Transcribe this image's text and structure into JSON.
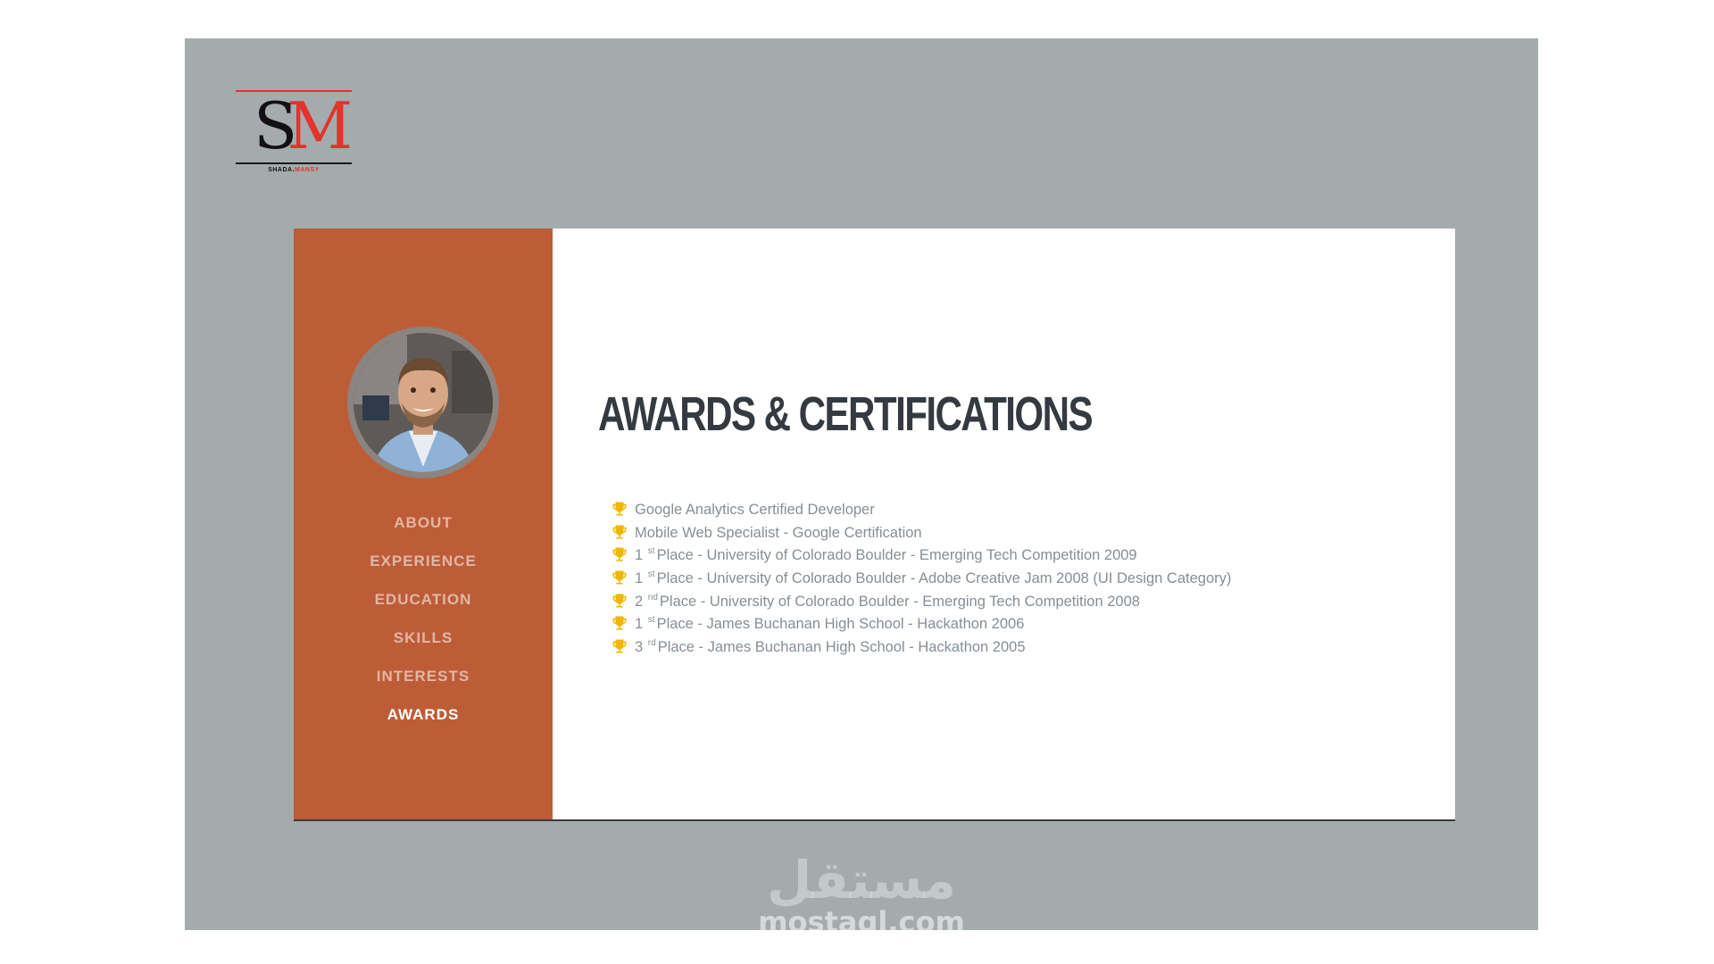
{
  "logo": {
    "mark_s": "S",
    "mark_m": "M",
    "sub_dark": "SHADA.",
    "sub_red": "MANSY"
  },
  "sidebar": {
    "accent_color": "#bd5d38",
    "nav": [
      {
        "label": "About",
        "active": false
      },
      {
        "label": "Experience",
        "active": false
      },
      {
        "label": "Education",
        "active": false
      },
      {
        "label": "Skills",
        "active": false
      },
      {
        "label": "Interests",
        "active": false
      },
      {
        "label": "Awards",
        "active": true
      }
    ]
  },
  "main": {
    "title": "AWARDS & CERTIFICATIONS",
    "trophy_color": "#f1b600",
    "awards": [
      {
        "text": "Google Analytics Certified Developer"
      },
      {
        "text": "Mobile Web Specialist - Google Certification"
      },
      {
        "num": "1",
        "sup": "st",
        "text": "Place - University of Colorado Boulder - Emerging Tech Competition 2009"
      },
      {
        "num": "1",
        "sup": "st",
        "text": "Place - University of Colorado Boulder - Adobe Creative Jam 2008 (UI Design Category)"
      },
      {
        "num": "2",
        "sup": "nd",
        "text": "Place - University of Colorado Boulder - Emerging Tech Competition 2008"
      },
      {
        "num": "1",
        "sup": "st",
        "text": "Place - James Buchanan High School - Hackathon 2006"
      },
      {
        "num": "3",
        "sup": "rd",
        "text": "Place - James Buchanan High School - Hackathon 2005"
      }
    ]
  },
  "watermark": {
    "arabic": "مستقل",
    "latin": "mostaql.com"
  }
}
